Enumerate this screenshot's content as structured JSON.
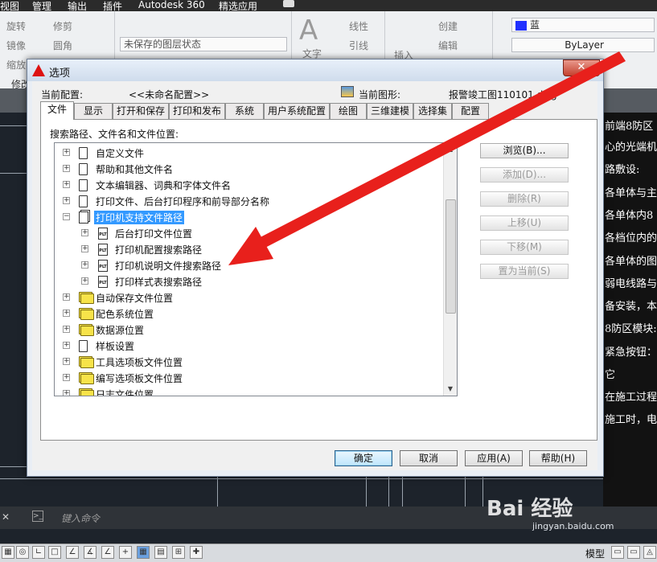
{
  "menubar": {
    "items": [
      "视图",
      "管理",
      "输出",
      "插件",
      "Autodesk 360",
      "精选应用"
    ]
  },
  "ribbon": {
    "modify_items": [
      "旋转",
      "修剪",
      "镜像",
      "圆角",
      "缩放"
    ],
    "panel_label": "修改",
    "layer_state": "未保存的图层状态",
    "text_label": "文字",
    "linear_label": "线性",
    "leader_label": "引线",
    "insert_label": "插入",
    "create_label": "创建",
    "edit_label": "编辑",
    "color_value": "蓝",
    "linetype_value": "ByLayer"
  },
  "notes": [
    "前端8防区",
    "心的光端机",
    "路敷设:",
    "各单体与主",
    "各单体内8",
    "各档位内的",
    "各单体的图",
    "弱电线路与",
    "备安装，本",
    "8防区模块:",
    "紧急按钮：安",
    "它",
    "在施工过程",
    "施工时，电"
  ],
  "command": {
    "placeholder": "键入命令"
  },
  "status": {
    "model_label": "模型"
  },
  "watermark": {
    "text": "Bai 经验",
    "sub": "jingyan.baidu.com"
  },
  "dialog": {
    "title": "选项",
    "close_glyph": "✕",
    "current_profile_label": "当前配置:",
    "current_profile_value": "<<未命名配置>>",
    "current_drawing_label": "当前图形:",
    "current_drawing_value": "报警竣工图110101.dwg",
    "tabs": [
      "文件",
      "显示",
      "打开和保存",
      "打印和发布",
      "系统",
      "用户系统配置",
      "绘图",
      "三维建模",
      "选择集",
      "配置"
    ],
    "active_tab": "文件",
    "tree_label": "搜索路径、文件名和文件位置:",
    "tree": [
      {
        "label": "自定义文件",
        "level": 0,
        "icon": "file-icon",
        "expander": "+"
      },
      {
        "label": "帮助和其他文件名",
        "level": 0,
        "icon": "file-icon",
        "expander": "+"
      },
      {
        "label": "文本编辑器、词典和字体文件名",
        "level": 0,
        "icon": "file-icon",
        "expander": "+"
      },
      {
        "label": "打印文件、后台打印程序和前导部分名称",
        "level": 0,
        "icon": "file-icon",
        "expander": "+"
      },
      {
        "label": "打印机支持文件路径",
        "level": 0,
        "icon": "file-stack-icon",
        "expander": "−",
        "selected": true
      },
      {
        "label": "后台打印文件位置",
        "level": 1,
        "icon": "plt-file-icon",
        "expander": "+"
      },
      {
        "label": "打印机配置搜索路径",
        "level": 1,
        "icon": "plt-file-icon",
        "expander": "+"
      },
      {
        "label": "打印机说明文件搜索路径",
        "level": 1,
        "icon": "plt-file-icon",
        "expander": "+"
      },
      {
        "label": "打印样式表搜索路径",
        "level": 1,
        "icon": "plt-file-icon",
        "expander": "+"
      },
      {
        "label": "自动保存文件位置",
        "level": 0,
        "icon": "folder-icon",
        "expander": "+"
      },
      {
        "label": "配色系统位置",
        "level": 0,
        "icon": "folder-icon",
        "expander": "+"
      },
      {
        "label": "数据源位置",
        "level": 0,
        "icon": "folder-icon",
        "expander": "+"
      },
      {
        "label": "样板设置",
        "level": 0,
        "icon": "file-icon",
        "expander": "+"
      },
      {
        "label": "工具选项板文件位置",
        "level": 0,
        "icon": "folder-icon",
        "expander": "+"
      },
      {
        "label": "编写选项板文件位置",
        "level": 0,
        "icon": "folder-icon",
        "expander": "+"
      },
      {
        "label": "日志文件位置",
        "level": 0,
        "icon": "folder-icon",
        "expander": "+"
      }
    ],
    "side_buttons": [
      {
        "label": "浏览(B)...",
        "enabled": true
      },
      {
        "label": "添加(D)...",
        "enabled": false
      },
      {
        "label": "删除(R)",
        "enabled": false
      },
      {
        "label": "上移(U)",
        "enabled": false
      },
      {
        "label": "下移(M)",
        "enabled": false
      },
      {
        "label": "置为当前(S)",
        "enabled": false
      }
    ],
    "buttons": {
      "ok": "确定",
      "cancel": "取消",
      "apply": "应用(A)",
      "help": "帮助(H)"
    }
  },
  "colors": {
    "selection": "#3399ff",
    "arrow": "#e8201c",
    "close_button": "#c4412f"
  }
}
